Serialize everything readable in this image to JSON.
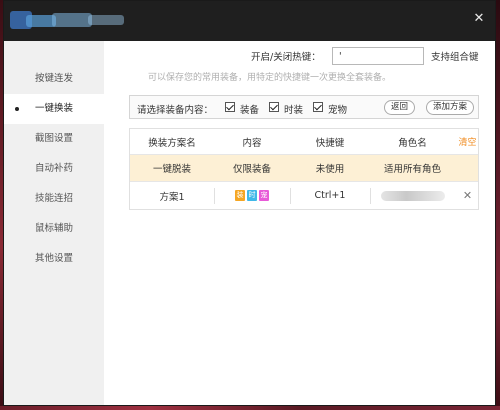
{
  "window": {
    "close_glyph": "✕"
  },
  "sidebar": {
    "items": [
      {
        "label": "按键连发",
        "active": false
      },
      {
        "label": "一键换装",
        "active": true
      },
      {
        "label": "截图设置",
        "active": false
      },
      {
        "label": "自动补药",
        "active": false
      },
      {
        "label": "技能连招",
        "active": false
      },
      {
        "label": "鼠标辅助",
        "active": false
      },
      {
        "label": "其他设置",
        "active": false
      }
    ]
  },
  "hotkey": {
    "label": "开启/关闭热键：",
    "value": "'",
    "combo_label": "支持组合键",
    "hint": "可以保存您的常用装备，用特定的快捷键一次更换全套装备。"
  },
  "select_bar": {
    "label": "请选择装备内容：",
    "options": [
      {
        "label": "装备",
        "checked": true
      },
      {
        "label": "时装",
        "checked": true
      },
      {
        "label": "宠物",
        "checked": true
      }
    ],
    "back_label": "返回",
    "add_label": "添加方案"
  },
  "table": {
    "headers": [
      "换装方案名",
      "内容",
      "快捷键",
      "角色名"
    ],
    "clear_label": "清空",
    "rows": [
      {
        "name": "一键脱装",
        "content": "仅限装备",
        "hotkey": "未使用",
        "role": "适用所有角色",
        "highlight": true
      },
      {
        "name": "方案1",
        "content_tags": [
          {
            "text": "装",
            "color": "#f5a623"
          },
          {
            "text": "时",
            "color": "#3fb8e8"
          },
          {
            "text": "宠",
            "color": "#e85ad8"
          }
        ],
        "hotkey": "Ctrl+1",
        "role": "",
        "delete": "✕",
        "highlight": false
      }
    ]
  },
  "colors": {
    "titlebar": "#1f1f1f",
    "sidebar_bg": "#f0f0f0",
    "highlight_row": "#fdf0d5",
    "clear_link": "#f08a1c"
  }
}
